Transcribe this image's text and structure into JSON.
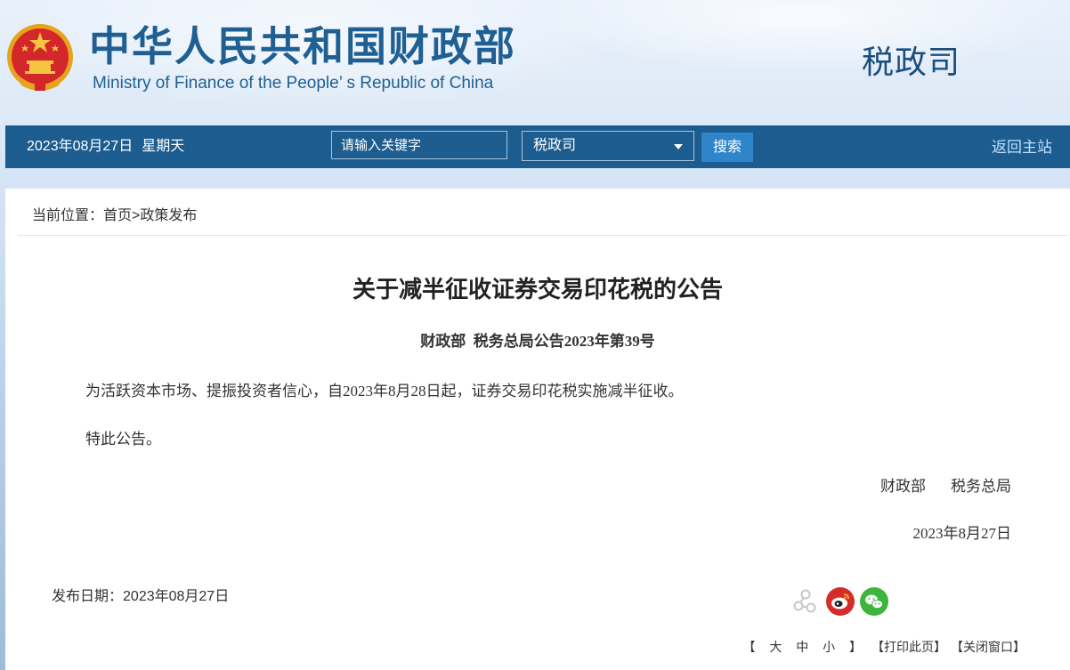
{
  "header": {
    "title_cn": "中华人民共和国财政部",
    "title_en": "Ministry of Finance of the People’ s Republic of China",
    "department": "税政司"
  },
  "navbar": {
    "date": "2023年08月27日",
    "weekday": "星期天",
    "search_placeholder": "请输入关键字",
    "scope_selected": "税政司",
    "search_button": "搜索",
    "home_link": "返回主站"
  },
  "breadcrumb": {
    "prefix": "当前位置：",
    "home": "首页",
    "separator": ">",
    "section": "政策发布"
  },
  "article": {
    "title": "关于减半征收证券交易印花税的公告",
    "doc_number": "财政部  税务总局公告2023年第39号",
    "paragraphs": [
      "为活跃资本市场、提振投资者信心，自2023年8月28日起，证券交易印花税实施减半征收。",
      "特此公告。"
    ],
    "signatories": [
      "财政部",
      "税务总局"
    ],
    "sign_date": "2023年8月27日"
  },
  "footer": {
    "publish_label": "发布日期：",
    "publish_date": "2023年08月27日",
    "font_size_label": "【 大 中 小 】",
    "print_label": "【打印此页】",
    "close_label": "【关闭窗口】"
  },
  "colors": {
    "navbar": "#1c5c8f",
    "title_blue": "#1f5f92",
    "search_button": "#2f85c9",
    "weibo": "#d52b2b",
    "wechat": "#3bb53b"
  },
  "icons": {
    "emblem": "national-emblem-icon",
    "share": "share-icon",
    "weibo": "weibo-icon",
    "wechat": "wechat-icon"
  }
}
